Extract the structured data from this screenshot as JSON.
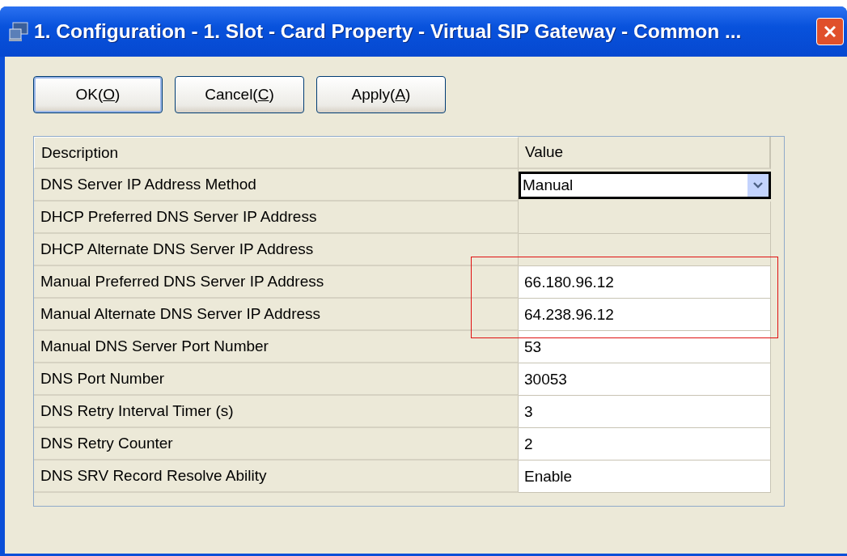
{
  "window": {
    "title": "1. Configuration - 1. Slot - Card Property - Virtual SIP Gateway - Common ..."
  },
  "buttons": [
    {
      "before": "OK(",
      "mnemonic": "O",
      "after": ")",
      "default": true
    },
    {
      "before": "Cancel(",
      "mnemonic": "C",
      "after": ")",
      "default": false
    },
    {
      "before": "Apply(",
      "mnemonic": "A",
      "after": ")",
      "default": false
    }
  ],
  "table": {
    "columns": [
      "Description",
      "Value"
    ],
    "rows": [
      {
        "description": "DNS Server IP Address Method",
        "kind": "dropdown",
        "value": "Manual",
        "highlighted": false
      },
      {
        "description": "DHCP Preferred DNS Server IP Address",
        "kind": "disabled",
        "highlighted": false
      },
      {
        "description": "DHCP Alternate DNS Server IP Address",
        "kind": "disabled",
        "highlighted": false
      },
      {
        "description": "Manual Preferred DNS Server IP Address",
        "kind": "text",
        "value": "66.180.96.12",
        "highlighted": true
      },
      {
        "description": "Manual Alternate DNS Server IP Address",
        "kind": "text",
        "value": "64.238.96.12",
        "highlighted": true
      },
      {
        "description": "Manual DNS Server Port Number",
        "kind": "text",
        "value": "53",
        "highlighted": false
      },
      {
        "description": "DNS Port Number",
        "kind": "text",
        "value": "30053",
        "highlighted": false
      },
      {
        "description": "DNS Retry Interval Timer (s)",
        "kind": "text",
        "value": "3",
        "highlighted": false
      },
      {
        "description": "DNS Retry Counter",
        "kind": "text",
        "value": "2",
        "highlighted": false
      },
      {
        "description": "DNS SRV Record Resolve Ability",
        "kind": "text",
        "value": "Enable",
        "highlighted": false
      }
    ]
  }
}
